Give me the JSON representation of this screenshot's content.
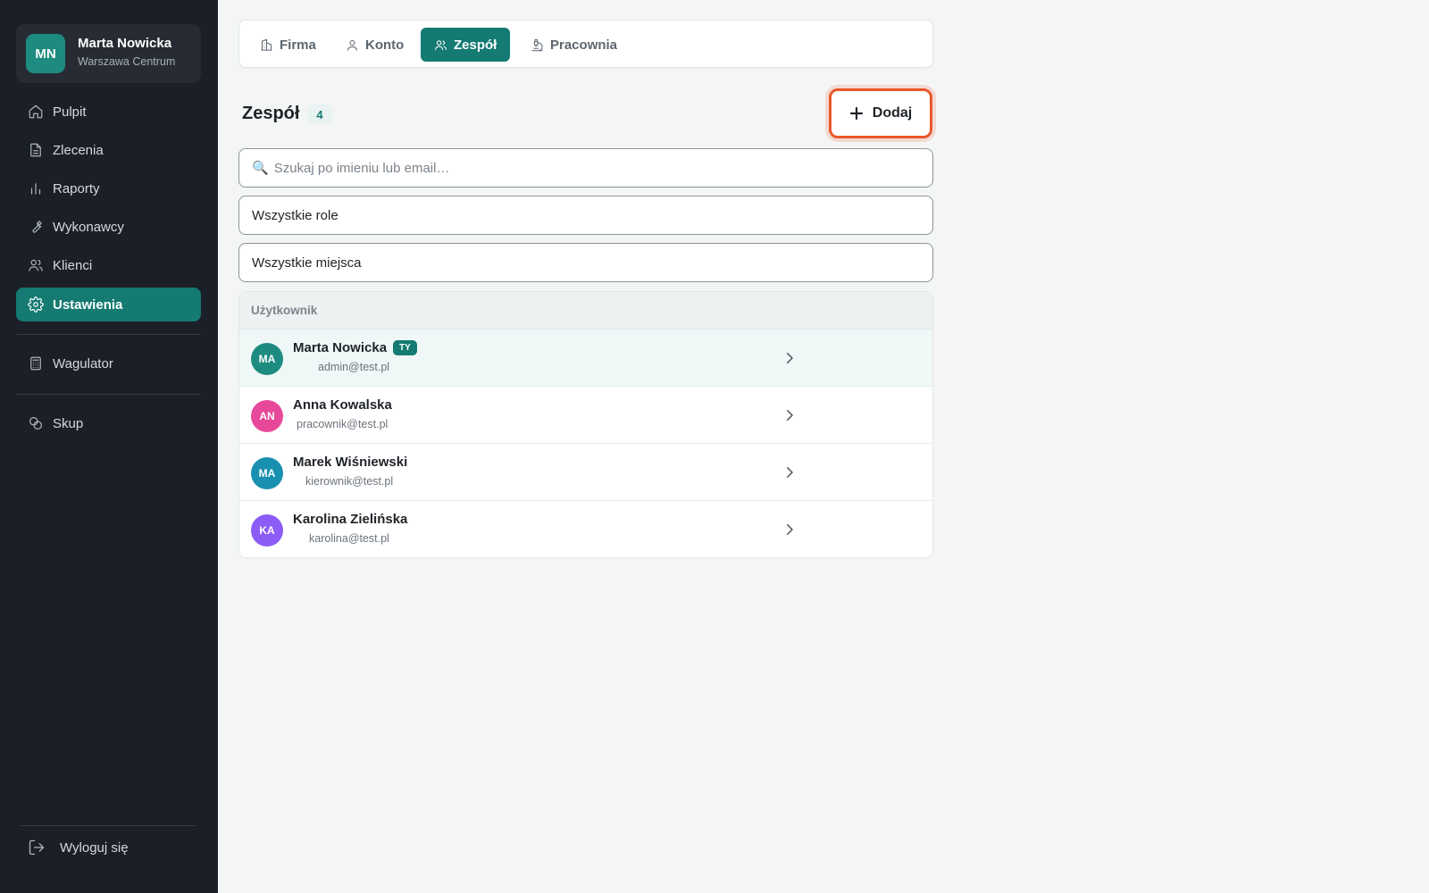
{
  "user": {
    "initials": "MN",
    "name": "Marta Nowicka",
    "location": "Warszawa Centrum",
    "avatar_color": "#1e8b80"
  },
  "sidebar": {
    "items": [
      {
        "label": "Pulpit",
        "icon": "home-icon"
      },
      {
        "label": "Zlecenia",
        "icon": "document-icon"
      },
      {
        "label": "Raporty",
        "icon": "bar-chart-icon"
      },
      {
        "label": "Wykonawcy",
        "icon": "wrench-icon"
      },
      {
        "label": "Klienci",
        "icon": "users-icon"
      },
      {
        "label": "Ustawienia",
        "icon": "gear-icon",
        "active": true
      }
    ],
    "secondary": [
      {
        "label": "Wagulator",
        "icon": "calculator-icon"
      },
      {
        "label": "Skup",
        "icon": "coins-icon"
      }
    ],
    "logout_label": "Wyloguj się"
  },
  "tabs": [
    {
      "label": "Firma",
      "icon": "building-icon"
    },
    {
      "label": "Konto",
      "icon": "user-icon"
    },
    {
      "label": "Zespół",
      "icon": "users-icon",
      "active": true
    },
    {
      "label": "Pracownia",
      "icon": "microscope-icon"
    }
  ],
  "team": {
    "title": "Zespół",
    "count": "4",
    "add_label": "Dodaj",
    "search_placeholder": "Szukaj po imieniu lub email…",
    "role_filter": "Wszystkie role",
    "place_filter": "Wszystkie miejsca",
    "column_user": "Użytkownik",
    "members": [
      {
        "initials": "MA",
        "name": "Marta Nowicka",
        "badge": "TY",
        "email": "admin@test.pl",
        "color": "#1e8b80"
      },
      {
        "initials": "AN",
        "name": "Anna Kowalska",
        "badge": "",
        "email": "pracownik@test.pl",
        "color": "#e8489a"
      },
      {
        "initials": "MA",
        "name": "Marek Wiśniewski",
        "badge": "",
        "email": "kierownik@test.pl",
        "color": "#1990b0"
      },
      {
        "initials": "KA",
        "name": "Karolina Zielińska",
        "badge": "",
        "email": "karolina@test.pl",
        "color": "#8b5cf6"
      }
    ]
  },
  "colors": {
    "accent": "#147a72",
    "sidebar_bg": "#1b1f27",
    "highlight": "#e8582a"
  }
}
